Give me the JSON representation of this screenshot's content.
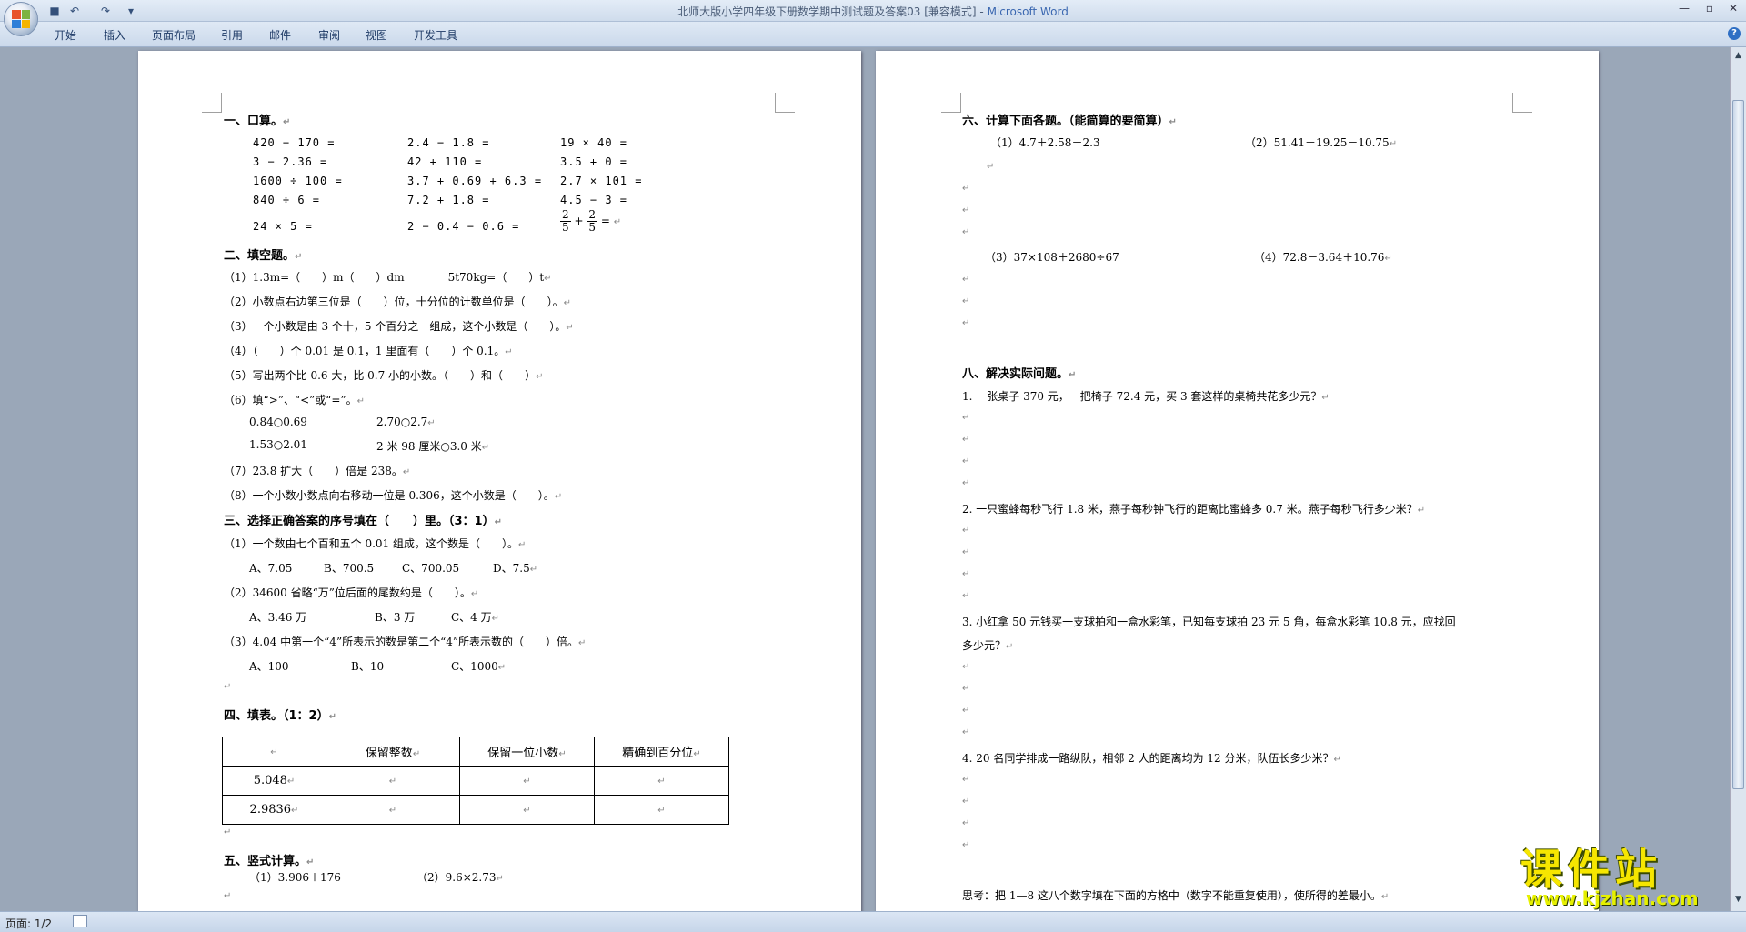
{
  "window": {
    "title": "北师大版小学四年级下册数学期中测试题及答案03 [兼容模式] - ",
    "app_name": "Microsoft Word",
    "accent": "#3a67b0"
  },
  "ribbon": {
    "tabs": [
      "开始",
      "插入",
      "页面布局",
      "引用",
      "邮件",
      "审阅",
      "视图",
      "开发工具"
    ],
    "help": "?"
  },
  "icons": {
    "office": "office-logo-icon",
    "save": "save-icon",
    "undo": "undo-icon",
    "redo": "redo-icon",
    "customize": "chevron-down-icon",
    "minimize": "minimize-icon",
    "maximize": "maximize-icon",
    "close": "close-icon"
  },
  "glyphs": {
    "para": "↵",
    "undo": "↶",
    "redo": "↷",
    "save": "■",
    "dropdown": "▾",
    "min": "—",
    "max": "▫",
    "close": "✕"
  },
  "page1": {
    "s1_title": "一、口算。",
    "oral": [
      [
        "420 − 170 =",
        "2.4 − 1.8 =",
        "19 × 40 ="
      ],
      [
        "3 − 2.36 =",
        "42 + 110 =",
        "3.5 + 0 ="
      ],
      [
        "1600 ÷ 100 =",
        "3.7 + 0.69 + 6.3 =",
        "2.7 × 101 ="
      ],
      [
        "840 ÷ 6 =",
        "7.2 + 1.8 =",
        "4.5 − 3 ="
      ]
    ],
    "oral_last": [
      "24 × 5 =",
      "2 − 0.4 − 0.6 ="
    ],
    "frac_num": "2",
    "frac_den": "5",
    "frac_plus": "+",
    "frac_eq": "=",
    "s2_title": "二、填空题。",
    "s2_1": "（1）1.3m=（　　）m（　　）dm　　　　5t70kg=（　　）t",
    "s2_2": "（2）小数点右边第三位是（　　）位，十分位的计数单位是（　　）。",
    "s2_3": "（3）一个小数是由 3 个十，5 个百分之一组成，这个小数是（　　）。",
    "s2_4": "（4）（　　）个 0.01 是 0.1，1 里面有（　　）个 0.1。",
    "s2_5": "（5）写出两个比 0.6 大，比 0.7 小的小数。（　　）和（　　）",
    "s2_6": "（6）填“>”、“<”或“=”。",
    "s2_6a": "0.84○0.69",
    "s2_6b": "2.70○2.7",
    "s2_6c": "1.53○2.01",
    "s2_6d": "2 米 98 厘米○3.0 米",
    "s2_7": "（7）23.8 扩大（　　）倍是 238。",
    "s2_8": "（8）一个小数小数点向右移动一位是 0.306，这个小数是（　　）。",
    "s3_title": "三、选择正确答案的序号填在（　　）里。（3：1）",
    "s3_1": "（1）一个数由七个百和五个 0.01 组成，这个数是（　　）。",
    "s3_1_opts": [
      "A、7.05",
      "B、700.5",
      "C、700.05",
      "D、7.5"
    ],
    "s3_2": "（2）34600 省略“万”位后面的尾数约是（　　）。",
    "s3_2_opts": [
      "A、3.46 万",
      "B、3 万",
      "C、4 万"
    ],
    "s3_3": "（3）4.04 中第一个“4”所表示的数是第二个“4”所表示数的（　　）倍。",
    "s3_3_opts": [
      "A、100",
      "B、10",
      "C、1000"
    ],
    "s4_title": "四、填表。（1：2）",
    "table_headers": [
      "保留整数",
      "保留一位小数",
      "精确到百分位"
    ],
    "table_rows": [
      "5.048",
      "2.9836"
    ],
    "s5_title": "五、竖式计算。",
    "s5_1": "（1）3.906＋176",
    "s5_2": "（2）9.6×2.73"
  },
  "page2": {
    "s6_title": "六、计算下面各题。（能简算的要简算）",
    "s6_1": "（1）4.7＋2.58－2.3",
    "s6_2": "（2）51.41－19.25－10.75",
    "s6_3": "（3）37×108＋2680÷67",
    "s6_4": "（4）72.8－3.64＋10.76",
    "s8_title": "八、解决实际问题。",
    "q1": "1. 一张桌子 370 元，一把椅子 72.4 元，买 3 套这样的桌椅共花多少元？",
    "q2": "2. 一只蜜蜂每秒飞行 1.8 米，燕子每秒钟飞行的距离比蜜蜂多 0.7 米。燕子每秒飞行多少米？",
    "q3a": "3. 小红拿 50 元钱买一支球拍和一盒水彩笔，已知每支球拍 23 元 5 角，每盒水彩笔 10.8 元，应找回",
    "q3b": "多少元？",
    "q4": "4. 20 名同学排成一路纵队，相邻 2 人的距离均为 12 分米，队伍长多少米？",
    "think": "思考：把 1—8 这八个数字填在下面的方格中（数字不能重复使用），使所得的差最小。"
  },
  "status": {
    "page": "页面: 1/2"
  },
  "watermark": {
    "title": "课件站",
    "url": "www.kjzhan.com"
  }
}
